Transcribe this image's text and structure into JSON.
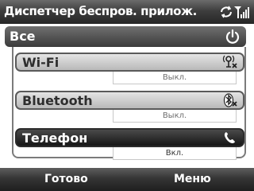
{
  "window": {
    "title": "Диспетчер беспров. прилож."
  },
  "status": {
    "icons": [
      "sync-icon",
      "signal-icon"
    ]
  },
  "all": {
    "label": "Все",
    "icon": "power-icon"
  },
  "rows": [
    {
      "label": "Wi-Fi",
      "state": "Выкл.",
      "icon": "wifi-off-icon",
      "selected": true
    },
    {
      "label": "Bluetooth",
      "state": "Выкл.",
      "icon": "bluetooth-off-icon",
      "selected": false
    },
    {
      "label": "Телефон",
      "state": "Вкл.",
      "icon": "phone-icon",
      "selected": false
    }
  ],
  "softkeys": {
    "left": "Готово",
    "right": "Меню"
  }
}
